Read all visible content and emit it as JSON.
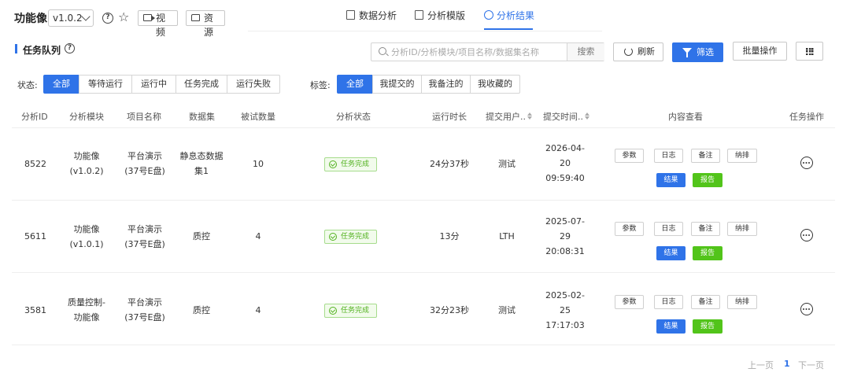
{
  "app": {
    "title": "功能像",
    "version": "v1.0.2",
    "video_label": "视频",
    "resource_label": "资源"
  },
  "tabs": [
    {
      "label": "数据分析",
      "icon": "edit-icon",
      "active": false
    },
    {
      "label": "分析模版",
      "icon": "document-icon",
      "active": false
    },
    {
      "label": "分析结果",
      "icon": "clock-icon",
      "active": true
    }
  ],
  "section": {
    "title": "任务队列"
  },
  "search": {
    "placeholder": "分析ID/分析模块/项目名称/数据集名称",
    "button": "搜索"
  },
  "toolbar": {
    "refresh": "刷新",
    "filter": "筛选",
    "batch": "批量操作"
  },
  "status_filter": {
    "label": "状态:",
    "options": [
      "全部",
      "等待运行",
      "运行中",
      "任务完成",
      "运行失败"
    ],
    "active": "全部"
  },
  "tag_filter": {
    "label": "标签:",
    "options": [
      "全部",
      "我提交的",
      "我备注的",
      "我收藏的"
    ],
    "active": "全部"
  },
  "table": {
    "headers": {
      "id": "分析ID",
      "module": "分析模块",
      "project": "项目名称",
      "dataset": "数据集",
      "subjects": "被试数量",
      "status": "分析状态",
      "duration": "运行时长",
      "user": "提交用户..",
      "time": "提交时间..",
      "content": "内容查看",
      "ops": "任务操作"
    },
    "actions": {
      "params": "参数",
      "log": "日志",
      "note": "备注",
      "rank": "纳排",
      "result": "结果",
      "report": "报告"
    },
    "rows": [
      {
        "id": "8522",
        "module": [
          "功能像",
          "(v1.0.2)"
        ],
        "project": [
          "平台演示",
          "(37号E盘)"
        ],
        "dataset": [
          "静息态数据",
          "集1"
        ],
        "subjects": "10",
        "status": "任务完成",
        "duration": "24分37秒",
        "user": "测试",
        "time": [
          "2026-04-",
          "20",
          "09:59:40"
        ]
      },
      {
        "id": "5611",
        "module": [
          "功能像",
          "(v1.0.1)"
        ],
        "project": [
          "平台演示",
          "(37号E盘)"
        ],
        "dataset": [
          "质控"
        ],
        "subjects": "4",
        "status": "任务完成",
        "duration": "13分",
        "user": "LTH",
        "time": [
          "2025-07-",
          "29",
          "20:08:31"
        ]
      },
      {
        "id": "3581",
        "module": [
          "质量控制-",
          "功能像"
        ],
        "project": [
          "平台演示",
          "(37号E盘)"
        ],
        "dataset": [
          "质控"
        ],
        "subjects": "4",
        "status": "任务完成",
        "duration": "32分23秒",
        "user": "测试",
        "time": [
          "2025-02-",
          "25",
          "17:17:03"
        ]
      }
    ]
  },
  "pagination": {
    "prev": "上一页",
    "current": "1",
    "next": "下一页"
  },
  "colors": {
    "primary": "#2f73e8",
    "success": "#52c41a"
  }
}
